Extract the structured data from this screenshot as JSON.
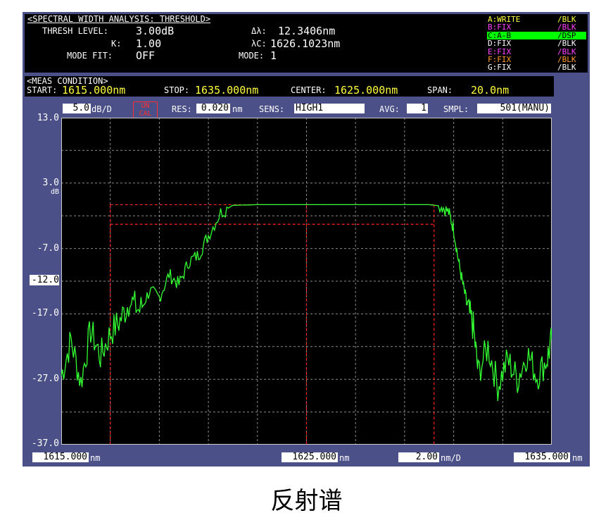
{
  "header": {
    "analysis_title": "<SPECTRAL WIDTH ANALYSIS: THRESHOLD>",
    "thresh_label": "THRESH LEVEL:",
    "thresh_value": "3.00dB",
    "k_label": "K:",
    "k_value": "1.00",
    "mode_fit_label": "MODE FIT:",
    "mode_fit_value": "OFF",
    "dl_label": "Δλ:",
    "dl_value": "12.3406nm",
    "lc_label": "λC:",
    "lc_value": "1626.1023nm",
    "mode_label": "MODE:",
    "mode_value": "1"
  },
  "traces": [
    {
      "name": "A:WRITE",
      "state": "/BLK",
      "color": "#ffff3c"
    },
    {
      "name": "B:FIX",
      "state": "/BLK",
      "color": "#ff40ff"
    },
    {
      "name": "C:A-B",
      "state": "/DSP",
      "color": "#000000",
      "highlight": "#00ff00"
    },
    {
      "name": "D:FIX",
      "state": "/BLK",
      "color": "#ffffff"
    },
    {
      "name": "E:FIX",
      "state": "/BLK",
      "color": "#ff40ff"
    },
    {
      "name": "F:FIX",
      "state": "/BLK",
      "color": "#ff9a2a"
    },
    {
      "name": "G:FIX",
      "state": "/BLK",
      "color": "#ffffff"
    }
  ],
  "meas": {
    "title": "<MEAS CONDITION>",
    "start_label": "START:",
    "start_value": "1615.000nm",
    "stop_label": "STOP:",
    "stop_value": "1635.000nm",
    "center_label": "CENTER:",
    "center_value": "1625.000nm",
    "span_label": "SPAN:",
    "span_value": "20.0nm"
  },
  "settings": {
    "scale_value": "5.0",
    "scale_unit": "dB/D",
    "unc_line1": "UN",
    "unc_line2": "CAL",
    "res_label": "RES:",
    "res_value": "0.020",
    "res_unit": "nm",
    "sens_label": "SENS:",
    "sens_value": "HIGH1",
    "avg_label": "AVG:",
    "avg_value": "1",
    "smpl_label": "SMPL:",
    "smpl_value": "501(MANU)"
  },
  "y_axis": {
    "ticks": [
      "13.0",
      "3.0",
      "-7.0",
      "-12.0",
      "-17.0",
      "-27.0",
      "-37.0"
    ],
    "unit": "dB",
    "ref_level": "-12.0"
  },
  "x_axis": {
    "left": "1615.000",
    "center": "1625.000",
    "right": "1635.000",
    "unit": "nm",
    "div_value": "2.00",
    "div_unit": "nm/D"
  },
  "colors": {
    "trace": "#33ff33",
    "threshold": "#ff2020",
    "grid": "#8a8a8a",
    "background": "#000000"
  },
  "chart_data": {
    "type": "line",
    "title": "",
    "xlabel": "nm",
    "ylabel": "dB",
    "xlim": [
      1615.0,
      1635.0
    ],
    "ylim": [
      -37.0,
      13.0
    ],
    "grid": true,
    "series": [
      {
        "x": [
          1615.0,
          1615.4,
          1615.8,
          1616.2,
          1616.6,
          1617.0,
          1617.4,
          1617.8,
          1618.2,
          1618.6,
          1619.0,
          1619.4,
          1619.8,
          1620.2,
          1620.6,
          1621.0,
          1621.5,
          1622.0,
          1623.0,
          1625.0,
          1627.0,
          1629.0,
          1630.0,
          1630.5,
          1630.8,
          1631.0,
          1631.2,
          1631.4,
          1631.6,
          1631.8,
          1632.0,
          1632.4,
          1632.8,
          1633.2,
          1633.6,
          1634.0,
          1634.4,
          1634.8,
          1635.0
        ],
        "values": [
          -26.5,
          -21.0,
          -27.5,
          -19.5,
          -23.5,
          -20.0,
          -18.0,
          -15.0,
          -16.5,
          -13.5,
          -14.5,
          -11.0,
          -12.5,
          -9.0,
          -8.0,
          -5.0,
          -1.5,
          -0.4,
          -0.3,
          -0.3,
          -0.3,
          -0.3,
          -0.3,
          -0.5,
          -1.5,
          -4.0,
          -9.0,
          -13.0,
          -16.5,
          -19.0,
          -26.0,
          -22.0,
          -28.0,
          -24.0,
          -27.0,
          -23.0,
          -26.5,
          -24.0,
          -21.0
        ]
      }
    ],
    "threshold_markers": {
      "x": [
        1617.0,
        1625.0,
        1630.2
      ],
      "y": [
        -0.3,
        -3.3
      ]
    }
  },
  "caption": "反射谱"
}
